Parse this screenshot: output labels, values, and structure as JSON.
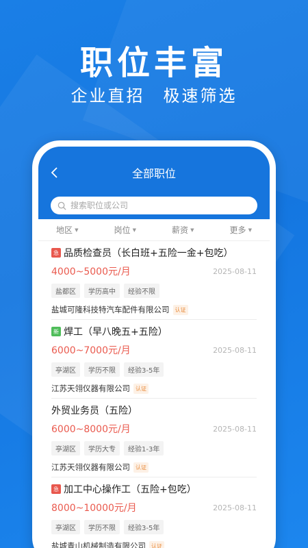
{
  "hero": {
    "title": "职位丰富",
    "subtitle": "企业直招　极速筛选"
  },
  "header": {
    "title": "全部职位",
    "back_icon": "chevron-left-icon"
  },
  "search": {
    "placeholder": "搜索职位或公司",
    "icon": "search-icon"
  },
  "filters": [
    {
      "label": "地区"
    },
    {
      "label": "岗位"
    },
    {
      "label": "薪资"
    },
    {
      "label": "更多"
    }
  ],
  "jobs": [
    {
      "tag": "急",
      "tag_type": "urgent",
      "title": "品质检查员（长白班+五险一金+包吃）",
      "salary": "4000~5000元/月",
      "date": "2025-08-11",
      "chips": [
        "盐都区",
        "学历高中",
        "经验不限"
      ],
      "company": "盐城可隆科技特汽车配件有限公司",
      "verify": "认证"
    },
    {
      "tag": "新",
      "tag_type": "new",
      "title": "焊工（早八晚五+五险）",
      "salary": "6000~7000元/月",
      "date": "2025-08-11",
      "chips": [
        "亭湖区",
        "学历不限",
        "经验3-5年"
      ],
      "company": "江苏天翎仪器有限公司",
      "verify": "认证"
    },
    {
      "tag": "",
      "tag_type": "",
      "title": "外贸业务员（五险）",
      "salary": "6000~8000元/月",
      "date": "2025-08-11",
      "chips": [
        "亭湖区",
        "学历大专",
        "经验1-3年"
      ],
      "company": "江苏天翎仪器有限公司",
      "verify": "认证"
    },
    {
      "tag": "急",
      "tag_type": "urgent",
      "title": "加工中心操作工（五险+包吃）",
      "salary": "8000~10000元/月",
      "date": "2025-08-11",
      "chips": [
        "亭湖区",
        "学历不限",
        "经验3-5年"
      ],
      "company": "盐城青山机械制造有限公司",
      "verify": "认证"
    }
  ],
  "colors": {
    "brand_blue": "#1675dd",
    "salary_red": "#ea5a4e",
    "urgent_tag": "#e8574d",
    "new_tag": "#4fbd5a",
    "verify_orange": "#e98a3a"
  }
}
